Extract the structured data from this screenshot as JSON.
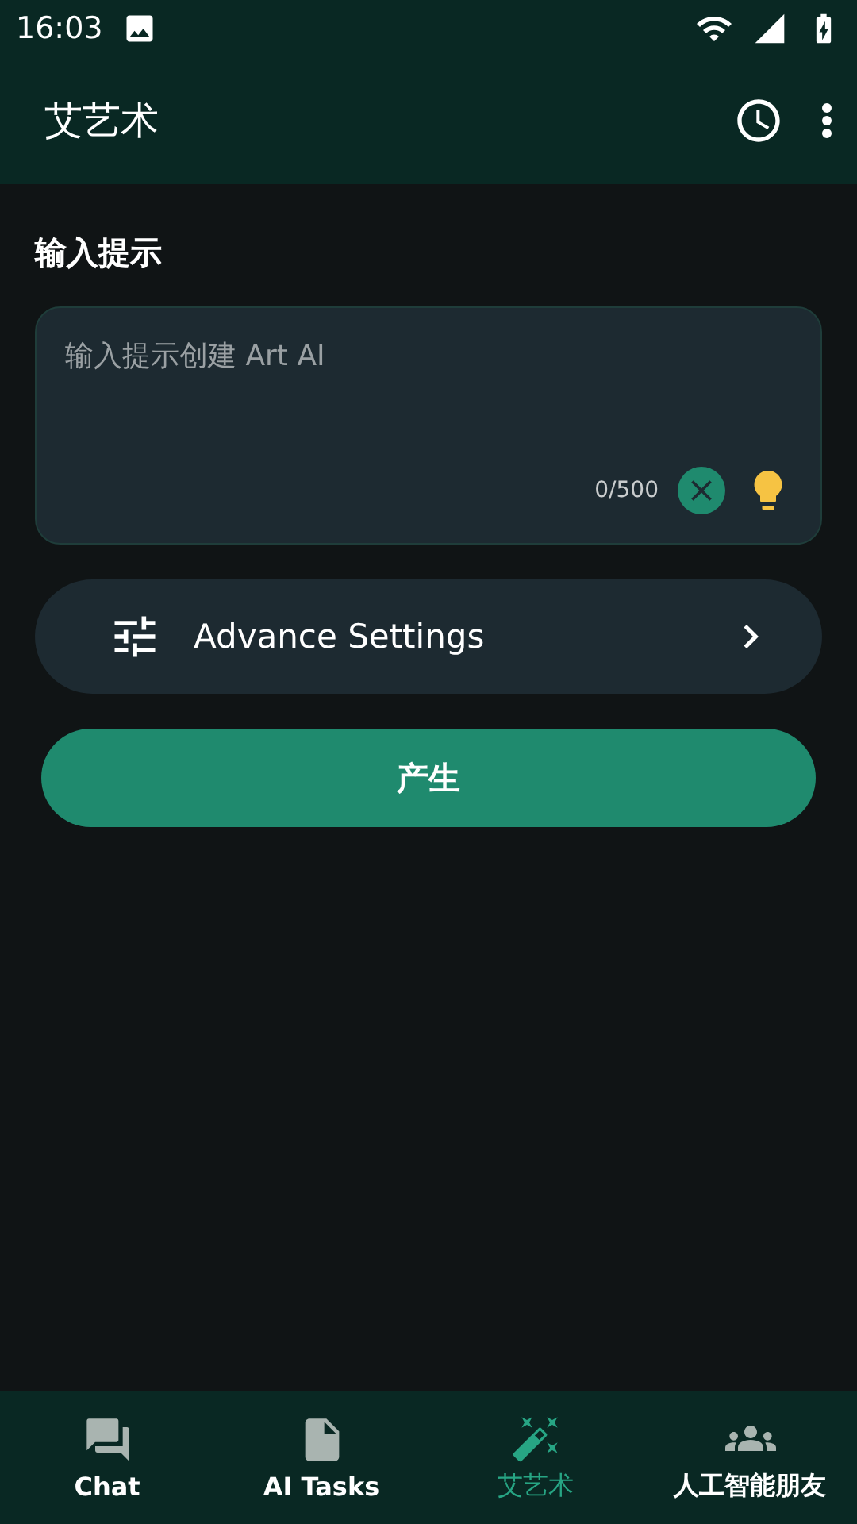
{
  "status_bar": {
    "time": "16:03"
  },
  "app_bar": {
    "title": "艾艺术"
  },
  "prompt": {
    "label": "输入提示",
    "placeholder": "输入提示创建 Art AI",
    "counter": "0/500"
  },
  "advance_settings": {
    "label": "Advance Settings"
  },
  "generate_button": {
    "label": "产生"
  },
  "bottom_nav": [
    {
      "kind": "chat",
      "label": "Chat",
      "selected": false
    },
    {
      "kind": "tasks",
      "label": "AI Tasks",
      "selected": false
    },
    {
      "kind": "art",
      "label": "艾艺术",
      "selected": true
    },
    {
      "kind": "friends",
      "label": "人工智能朋友",
      "selected": false
    }
  ]
}
